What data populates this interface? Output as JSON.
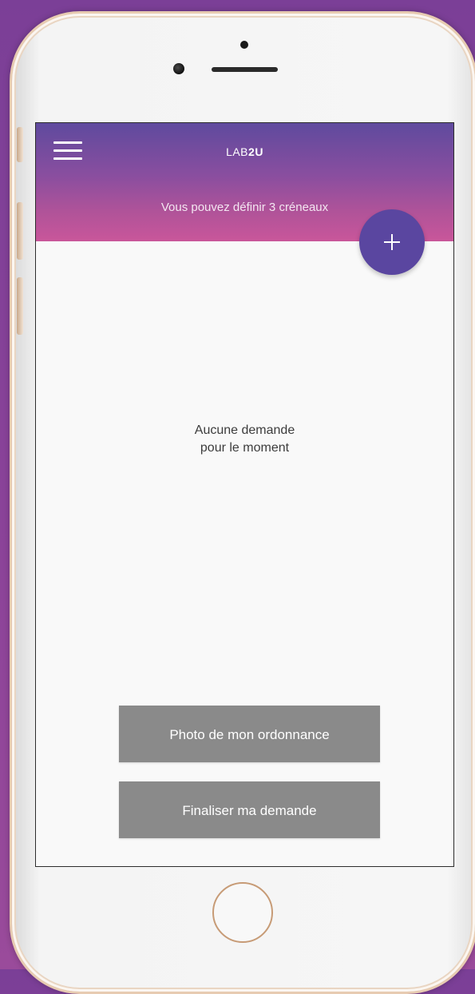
{
  "app": {
    "logo_prefix": "LAB",
    "logo_suffix": "2U"
  },
  "header": {
    "slots_info": "Vous pouvez définir 3 créneaux"
  },
  "empty_state": {
    "line1": "Aucune demande",
    "line2": "pour le moment"
  },
  "actions": {
    "photo_label": "Photo de mon ordonnance",
    "finalize_label": "Finaliser ma demande"
  },
  "icons": {
    "menu": "hamburger-menu-icon",
    "add": "plus-icon"
  },
  "colors": {
    "header_top": "#5f4a9e",
    "header_bottom": "#c9569a",
    "fab": "#5a46a0",
    "button_gray": "#8a8a8a"
  }
}
